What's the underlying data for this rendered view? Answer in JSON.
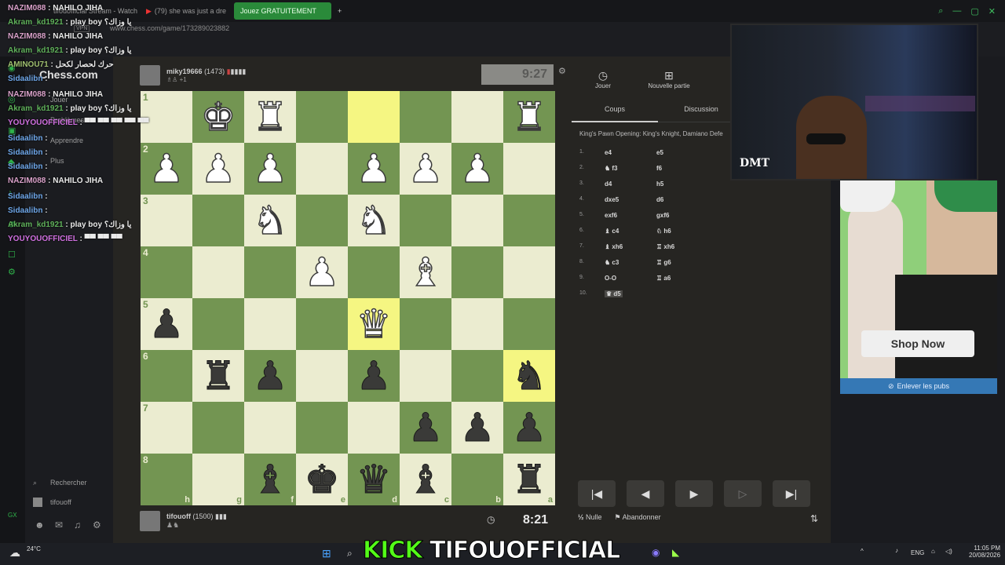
{
  "browser": {
    "tabs": [
      "tifouofficial Stream - Watch",
      "(79) she was just a dre",
      "Jouez GRATUITEMENT"
    ],
    "url": "www.chess.com/game/173289023882",
    "vpn": "VPN"
  },
  "sidebar": {
    "logo": "Chess.com",
    "items": [
      "Jouer",
      "Problèmes",
      "Apprendre",
      "Plus"
    ],
    "search": "Rechercher",
    "user": "tifouoff"
  },
  "top_player": {
    "name": "miky19666",
    "rating": "(1473)",
    "extra": "+1",
    "clock": "9:27"
  },
  "bottom_player": {
    "name": "tifouoff",
    "rating": "(1500)",
    "clock": "8:21"
  },
  "board": {
    "ranks": [
      "1",
      "2",
      "3",
      "4",
      "5",
      "6",
      "7",
      "8"
    ],
    "files": [
      "h",
      "g",
      "f",
      "e",
      "d",
      "c",
      "b",
      "a"
    ],
    "rows": [
      [
        "",
        "wK",
        "wR",
        "",
        "",
        "",
        "",
        "wR"
      ],
      [
        "wP",
        "wP",
        "wP",
        "",
        "wP",
        "wP",
        "wP",
        ""
      ],
      [
        "",
        "",
        "wN",
        "",
        "wN",
        "",
        "",
        ""
      ],
      [
        "",
        "",
        "",
        "wP",
        "",
        "wB",
        "",
        ""
      ],
      [
        "bP",
        "",
        "",
        "",
        "wQ",
        "",
        "",
        ""
      ],
      [
        "",
        "bR",
        "bP",
        "",
        "bP",
        "",
        "",
        "bN"
      ],
      [
        "",
        "",
        "",
        "",
        "",
        "bP",
        "bP",
        "bP"
      ],
      [
        "",
        "",
        "bB",
        "bK",
        "bQ",
        "bB",
        "",
        "bR"
      ]
    ],
    "highlights": [
      [
        0,
        4
      ],
      [
        4,
        4
      ],
      [
        5,
        7
      ]
    ]
  },
  "panel": {
    "top_buttons": [
      "Jouer",
      "Nouvelle partie"
    ],
    "tabs": [
      "Coups",
      "Discussion"
    ],
    "opening": "King's Pawn Opening: King's Knight, Damiano Defe",
    "moves": [
      {
        "n": "1.",
        "w": "e4",
        "b": "e5"
      },
      {
        "n": "2.",
        "w": "♞ f3",
        "b": "f6"
      },
      {
        "n": "3.",
        "w": "d4",
        "b": "h5"
      },
      {
        "n": "4.",
        "w": "dxe5",
        "b": "d6"
      },
      {
        "n": "5.",
        "w": "exf6",
        "b": "gxf6"
      },
      {
        "n": "6.",
        "w": "♝ c4",
        "b": "♘ h6"
      },
      {
        "n": "7.",
        "w": "♝ xh6",
        "b": "♖ xh6"
      },
      {
        "n": "8.",
        "w": "♞ c3",
        "b": "♖ g6"
      },
      {
        "n": "9.",
        "w": "O-O",
        "b": "♖ a6"
      },
      {
        "n": "10.",
        "w": "♛ d5",
        "b": ""
      }
    ],
    "draw": "Nulle",
    "resign": "Abandonner"
  },
  "ad": {
    "shop": "Shop Now",
    "remove": "Enlever les pubs"
  },
  "cam": {
    "tag": "DMT"
  },
  "chat": [
    {
      "name": "NAZIM088",
      "msg": ": NAHILO JIHA",
      "c": "n"
    },
    {
      "name": "Akram_kd1921",
      "msg": ": play boy يا وزاك؟",
      "c": "a"
    },
    {
      "name": "NAZIM088",
      "msg": ": NAHILO JIHA",
      "c": "n"
    },
    {
      "name": "Akram_kd1921",
      "msg": ": play boy يا وزاك؟",
      "c": "a"
    },
    {
      "name": "AMINOU71",
      "msg": ": حرك لحصار لكحل",
      "c": "m"
    },
    {
      "name": "Sidaalibn",
      "msg": ":",
      "c": "s"
    },
    {
      "name": "NAZIM088",
      "msg": ": NAHILO JIHA",
      "c": "n"
    },
    {
      "name": "Akram_kd1921",
      "msg": ": play boy يا وزاك؟",
      "c": "a"
    },
    {
      "name": "YOUYOUOFFICIEL",
      "msg": ": ▀▀ ▀▀ ▀▀ ▀▀ ▀▀",
      "c": "y"
    },
    {
      "name": "Sidaalibn",
      "msg": ":",
      "c": "s"
    },
    {
      "name": "Sidaalibn",
      "msg": ":",
      "c": "s"
    },
    {
      "name": "Sidaalibn",
      "msg": ":",
      "c": "s"
    },
    {
      "name": "NAZIM088",
      "msg": ": NAHILO JIHA",
      "c": "n"
    },
    {
      "name": "Sidaalibn",
      "msg": ":",
      "c": "s"
    },
    {
      "name": "Sidaalibn",
      "msg": ":",
      "c": "s"
    },
    {
      "name": "Akram_kd1921",
      "msg": ": play boy يا وزاك؟",
      "c": "a"
    },
    {
      "name": "YOUYOUOFFICIEL",
      "msg": ": ▀▀ ▀▀ ▀▀",
      "c": "y"
    }
  ],
  "overlay": {
    "kick": "KICK",
    "channel": "TIFOUOFFICIAL"
  },
  "taskbar": {
    "weather": "24°C",
    "lang": "ENG",
    "time": "11:05 PM",
    "date": "20/08/2026"
  }
}
